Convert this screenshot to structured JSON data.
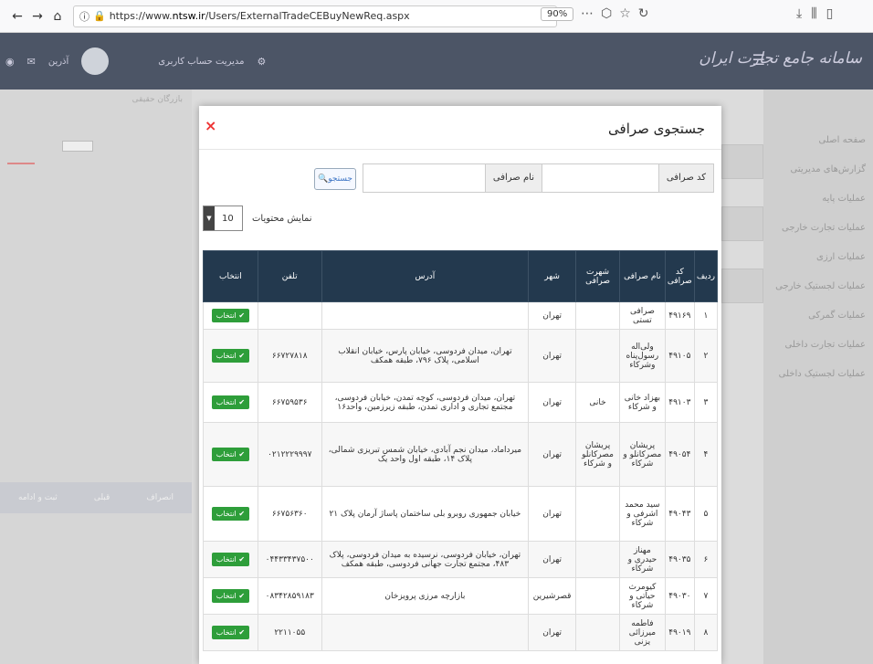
{
  "browser": {
    "url_prefix": "https://www.",
    "url_domain": "ntsw.ir",
    "url_path": "/Users/ExternalTradeCEBuyNewReq.aspx",
    "zoom": "90%"
  },
  "header": {
    "brand": "سامانه جامع تجارت ایران",
    "user_name": "آذرین",
    "account_mgmt": "مدیریت حساب کاربری"
  },
  "sidebar": {
    "items": [
      "صفحه اصلی",
      "گزارش‌های مدیریتی",
      "عملیات پایه",
      "عملیات تجارت خارجی",
      "عملیات ارزی",
      "عملیات لجستیک خارجی",
      "عملیات گمرکی",
      "عملیات تجارت داخلی",
      "عملیات لجستیک داخلی"
    ]
  },
  "background": {
    "merchant_label": "بازرگان حقیقی",
    "tools": [
      "ثبت و ادامه",
      "قبلی",
      "انصراف"
    ]
  },
  "modal": {
    "title": "جستجوی صرافی",
    "close": "×",
    "code_label": "کد صرافی",
    "name_label": "نام صرافی",
    "search_button": "جستجو",
    "show_label": "نمایش محتویات",
    "page_size": "10"
  },
  "table": {
    "headers": [
      "ردیف",
      "کد صرافی",
      "نام صرافی",
      "شهرت صرافی",
      "شهر",
      "آدرس",
      "تلفن",
      "انتخاب"
    ],
    "select_label": "✔ انتخاب",
    "rows": [
      {
        "idx": "۱",
        "code": "۴۹۱۶۹",
        "name": "صرافی تستی",
        "fame": "",
        "city": "تهران",
        "address": "",
        "phone": ""
      },
      {
        "idx": "۲",
        "code": "۴۹۱۰۵",
        "name": "ولی‌اله رسول‌پناه وشرکاء",
        "fame": "",
        "city": "تهران",
        "address": "تهران، میدان فردوسی، خیابان پارس، خیابان انقلاب اسلامی، پلاک ۷۹۶، طبقه همکف",
        "phone": "۶۶۷۲۷۸۱۸"
      },
      {
        "idx": "۳",
        "code": "۴۹۱۰۳",
        "name": "بهزاد خانی و شرکاء",
        "fame": "خانی",
        "city": "تهران",
        "address": "تهران، میدان فردوسی، کوچه تمدن، خیابان فردوسی، مجتمع تجاری و اداری تمدن، طبقه زیرزمین، واحد۱۶",
        "phone": "۶۶۷۵۹۵۳۶"
      },
      {
        "idx": "۴",
        "code": "۴۹۰۵۴",
        "name": "پریشان مصرکانلو و شرکاء",
        "fame": "پریشان مصرکانلو و شرکاء",
        "city": "تهران",
        "address": "میرداماد، میدان نجم آبادی، خیابان شمس تبریزی شمالی، پلاک ۱۴، طبقه اول واحد یک",
        "phone": "۰۲۱۲۲۲۹۹۹۷"
      },
      {
        "idx": "۵",
        "code": "۴۹۰۴۳",
        "name": "سید محمد اشرفی و شرکاء",
        "fame": "",
        "city": "تهران",
        "address": "خیابان جمهوری روبرو بلی ساختمان پاساژ آرمان پلاک ۲۱",
        "phone": "۶۶۷۵۶۳۶۰"
      },
      {
        "idx": "۶",
        "code": "۴۹۰۳۵",
        "name": "مهناز حیدری و شرکاء",
        "fame": "",
        "city": "تهران",
        "address": "تهران، خیابان فردوسی، نرسیده به میدان فردوسی، پلاک ۴۸۳، مجتمع تجارت جهانی فردوسی، طبقه همکف",
        "phone": "۰۴۴۳۳۴۳۷۵۰۰"
      },
      {
        "idx": "۷",
        "code": "۴۹۰۳۰",
        "name": "کیومرث حیاتی و شرکاء",
        "fame": "",
        "city": "قصرشیرین",
        "address": "بازارچه مرزی پرویزخان",
        "phone": "۰۸۳۴۲۸۵۹۱۸۳"
      },
      {
        "idx": "۸",
        "code": "۴۹۰۱۹",
        "name": "فاطمه میرزائی یزنی",
        "fame": "",
        "city": "تهران",
        "address": "",
        "phone": "۲۲۱۱۰۵۵"
      }
    ]
  },
  "colors": {
    "table_header": "#23394e",
    "select_button": "#2e9e3a",
    "close": "#e33333",
    "app_header": "#4c5566"
  }
}
